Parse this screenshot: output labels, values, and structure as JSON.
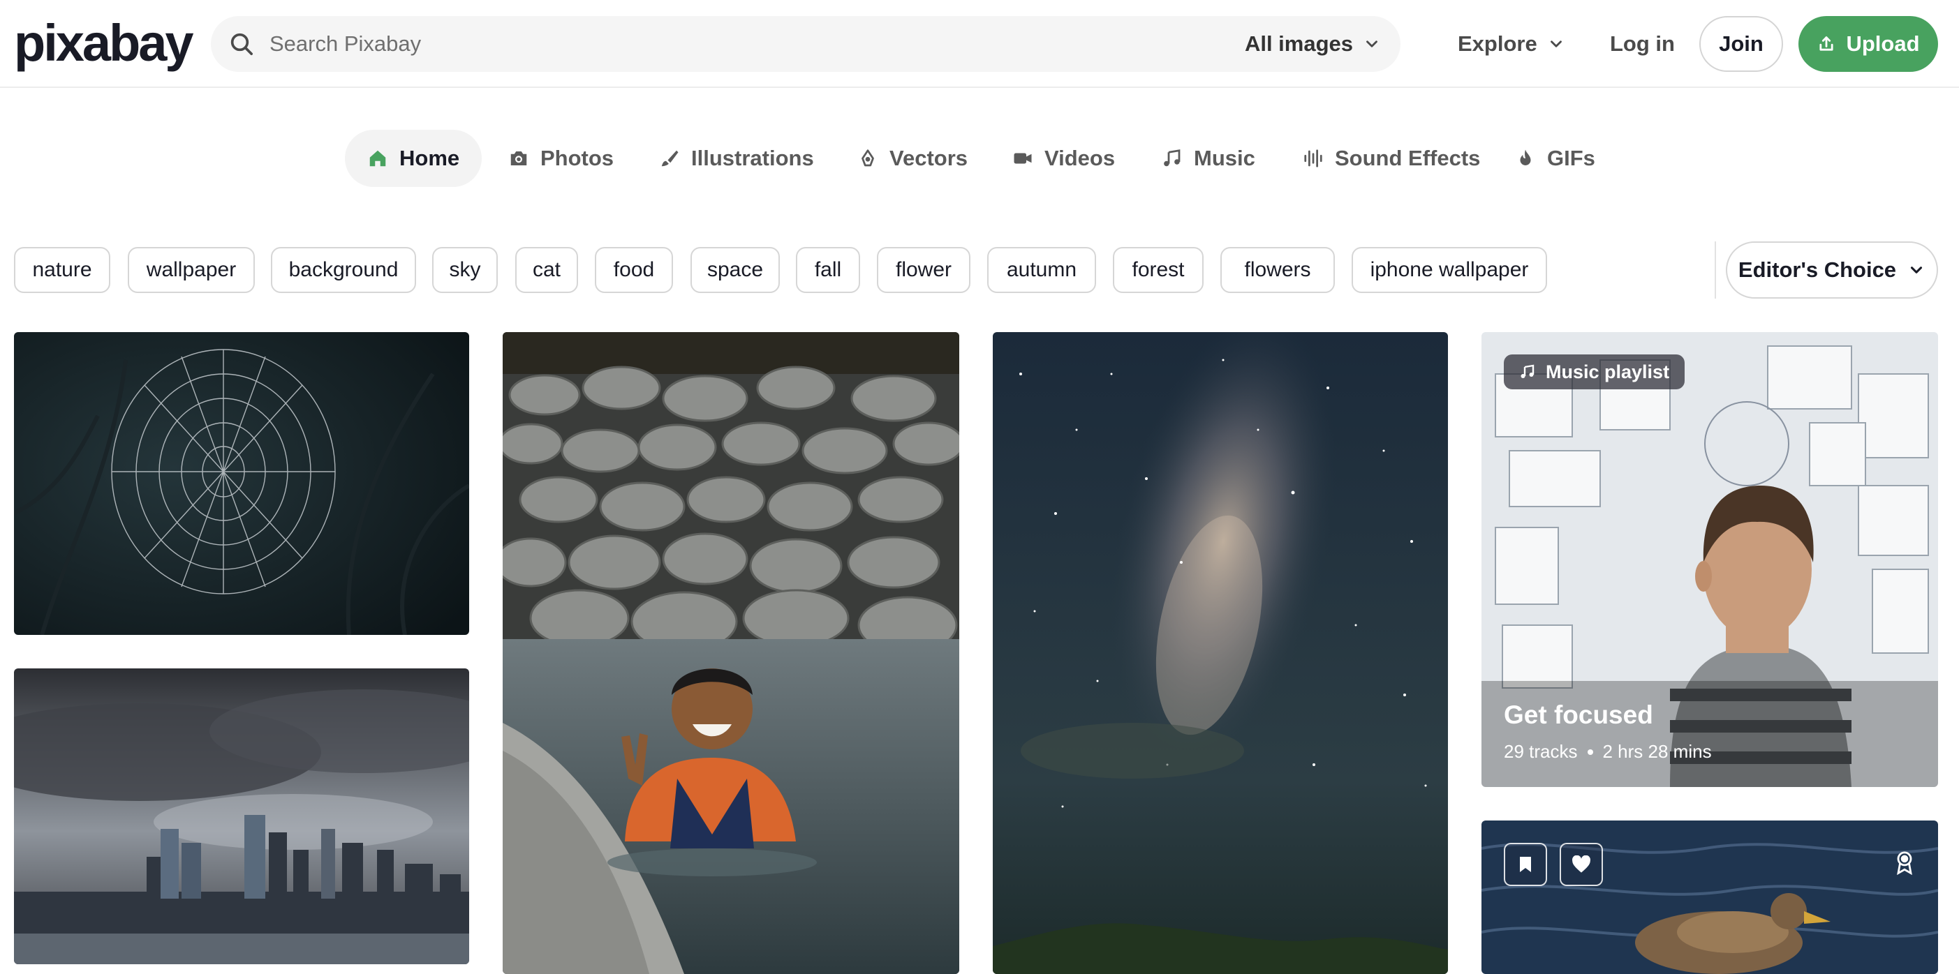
{
  "brand": {
    "logo_text": "pixabay"
  },
  "search": {
    "placeholder": "Search Pixabay",
    "scope_label": "All images"
  },
  "nav": {
    "explore_label": "Explore",
    "login_label": "Log in",
    "join_label": "Join",
    "upload_label": "Upload"
  },
  "tabs": [
    {
      "label": "Home",
      "icon": "home-icon",
      "active": true
    },
    {
      "label": "Photos",
      "icon": "camera-icon"
    },
    {
      "label": "Illustrations",
      "icon": "brush-icon"
    },
    {
      "label": "Vectors",
      "icon": "pen-nib-icon"
    },
    {
      "label": "Videos",
      "icon": "video-camera-icon"
    },
    {
      "label": "Music",
      "icon": "music-note-icon"
    },
    {
      "label": "Sound Effects",
      "icon": "waveform-icon"
    },
    {
      "label": "GIFs",
      "icon": "flame-icon"
    }
  ],
  "chips": [
    "nature",
    "wallpaper",
    "background",
    "sky",
    "cat",
    "food",
    "space",
    "fall",
    "flower",
    "autumn",
    "forest",
    "flowers",
    "iphone wallpaper"
  ],
  "editors_choice_label": "Editor's Choice",
  "playlist": {
    "badge_label": "Music playlist",
    "title": "Get focused",
    "tracks": "29 tracks",
    "duration": "2 hrs 28 mins"
  },
  "colors": {
    "accent": "#48a25f",
    "text": "#191b26",
    "chip_border": "#d6d6d6"
  }
}
